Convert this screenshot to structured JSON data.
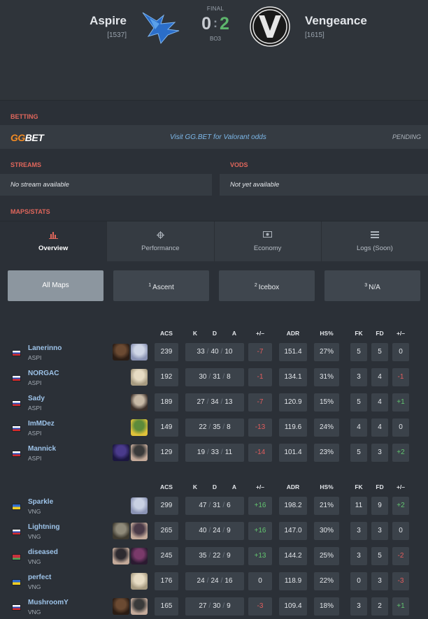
{
  "match": {
    "team1": {
      "name": "Aspire",
      "rating": "[1537]",
      "score": "0"
    },
    "team2": {
      "name": "Vengeance",
      "rating": "[1615]",
      "score": "2"
    },
    "status": "FINAL",
    "format": "BO3",
    "separator": ":"
  },
  "betting": {
    "label": "BETTING",
    "logo_gg": "GG",
    "logo_bet": "BET",
    "link": "Visit GG.BET for Valorant odds",
    "status": "PENDING"
  },
  "streams": {
    "label": "STREAMS",
    "value": "No stream available"
  },
  "vods": {
    "label": "VODS",
    "value": "Not yet available"
  },
  "maps_stats": {
    "label": "MAPS/STATS"
  },
  "tabs": [
    {
      "label": "Overview",
      "icon": "bar-chart-icon"
    },
    {
      "label": "Performance",
      "icon": "crosshair-icon"
    },
    {
      "label": "Economy",
      "icon": "money-icon"
    },
    {
      "label": "Logs (Soon)",
      "icon": "list-icon"
    }
  ],
  "maps": [
    {
      "num": "",
      "label": "All Maps"
    },
    {
      "num": "1",
      "label": "Ascent"
    },
    {
      "num": "2",
      "label": "Icebox"
    },
    {
      "num": "3",
      "label": "N/A"
    }
  ],
  "columns": {
    "acs": "ACS",
    "k": "K",
    "d": "D",
    "a": "A",
    "pm": "+/–",
    "adr": "ADR",
    "hs": "HS%",
    "fk": "FK",
    "fd": "FD",
    "fpm": "+/–",
    "slash": "/"
  },
  "team1_players": [
    {
      "name": "Lanerinno",
      "team": "ASPI",
      "acs": "239",
      "k": "33",
      "d": "40",
      "a": "10",
      "pm": "-7",
      "adr": "151.4",
      "hs": "27%",
      "fk": "5",
      "fd": "5",
      "fpm": "0"
    },
    {
      "name": "NORGAC",
      "team": "ASPI",
      "acs": "192",
      "k": "30",
      "d": "31",
      "a": "8",
      "pm": "-1",
      "adr": "134.1",
      "hs": "31%",
      "fk": "3",
      "fd": "4",
      "fpm": "-1"
    },
    {
      "name": "Sady",
      "team": "ASPI",
      "acs": "189",
      "k": "27",
      "d": "34",
      "a": "13",
      "pm": "-7",
      "adr": "120.9",
      "hs": "15%",
      "fk": "5",
      "fd": "4",
      "fpm": "+1"
    },
    {
      "name": "ImMDez",
      "team": "ASPI",
      "acs": "149",
      "k": "22",
      "d": "35",
      "a": "8",
      "pm": "-13",
      "adr": "119.6",
      "hs": "24%",
      "fk": "4",
      "fd": "4",
      "fpm": "0"
    },
    {
      "name": "Mannick",
      "team": "ASPI",
      "acs": "129",
      "k": "19",
      "d": "33",
      "a": "11",
      "pm": "-14",
      "adr": "101.4",
      "hs": "23%",
      "fk": "5",
      "fd": "3",
      "fpm": "+2"
    }
  ],
  "team2_players": [
    {
      "name": "Sparkle",
      "team": "VNG",
      "acs": "299",
      "k": "47",
      "d": "31",
      "a": "6",
      "pm": "+16",
      "adr": "198.2",
      "hs": "21%",
      "fk": "11",
      "fd": "9",
      "fpm": "+2"
    },
    {
      "name": "Lightning",
      "team": "VNG",
      "acs": "265",
      "k": "40",
      "d": "24",
      "a": "9",
      "pm": "+16",
      "adr": "147.0",
      "hs": "30%",
      "fk": "3",
      "fd": "3",
      "fpm": "0"
    },
    {
      "name": "diseased",
      "team": "VNG",
      "acs": "245",
      "k": "35",
      "d": "22",
      "a": "9",
      "pm": "+13",
      "adr": "144.2",
      "hs": "25%",
      "fk": "3",
      "fd": "5",
      "fpm": "-2"
    },
    {
      "name": "perfect",
      "team": "VNG",
      "acs": "176",
      "k": "24",
      "d": "24",
      "a": "16",
      "pm": "0",
      "adr": "118.9",
      "hs": "22%",
      "fk": "0",
      "fd": "3",
      "fpm": "-3"
    },
    {
      "name": "MushroomY",
      "team": "VNG",
      "acs": "165",
      "k": "27",
      "d": "30",
      "a": "9",
      "pm": "-3",
      "adr": "109.4",
      "hs": "18%",
      "fk": "3",
      "fd": "2",
      "fpm": "+1"
    }
  ]
}
